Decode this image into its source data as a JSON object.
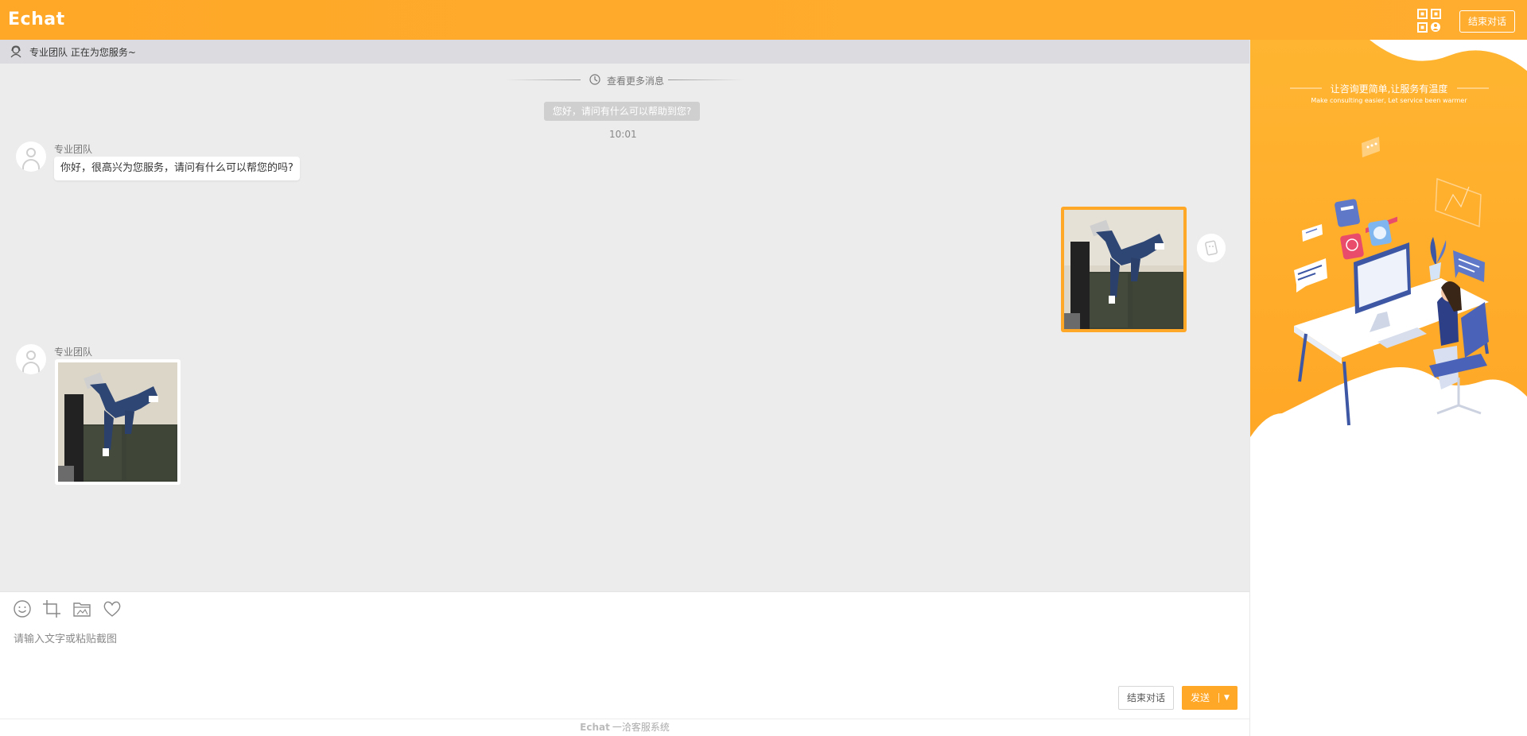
{
  "app": {
    "logo": "Echat",
    "end_chat_top": "结束对话"
  },
  "chat": {
    "status_text": "专业团队 正在为您服务~",
    "view_more": "查看更多消息",
    "system_message": "您好，请问有什么可以帮助到您?",
    "timestamp": "10:01",
    "messages": [
      {
        "sender": "专业团队",
        "text": "你好，很高兴为您服务，请问有什么可以帮您的吗?"
      },
      {
        "sender": "专业团队",
        "type": "image"
      }
    ]
  },
  "input": {
    "placeholder": "请输入文字或粘贴截图",
    "end_button": "结束对话",
    "send_button": "发送",
    "send_dropdown": "▼",
    "tools": [
      "emoji-icon",
      "crop-icon",
      "folder-icon",
      "heart-icon"
    ]
  },
  "footer": {
    "logo": "Echat",
    "text": "一洽客服系统"
  },
  "side": {
    "slogan": "让咨询更简单,让服务有温度",
    "slogan_en": "Make consulting easier, Let service been warmer"
  },
  "colors": {
    "accent": "#ffa726",
    "chat_bg": "#ececec"
  }
}
